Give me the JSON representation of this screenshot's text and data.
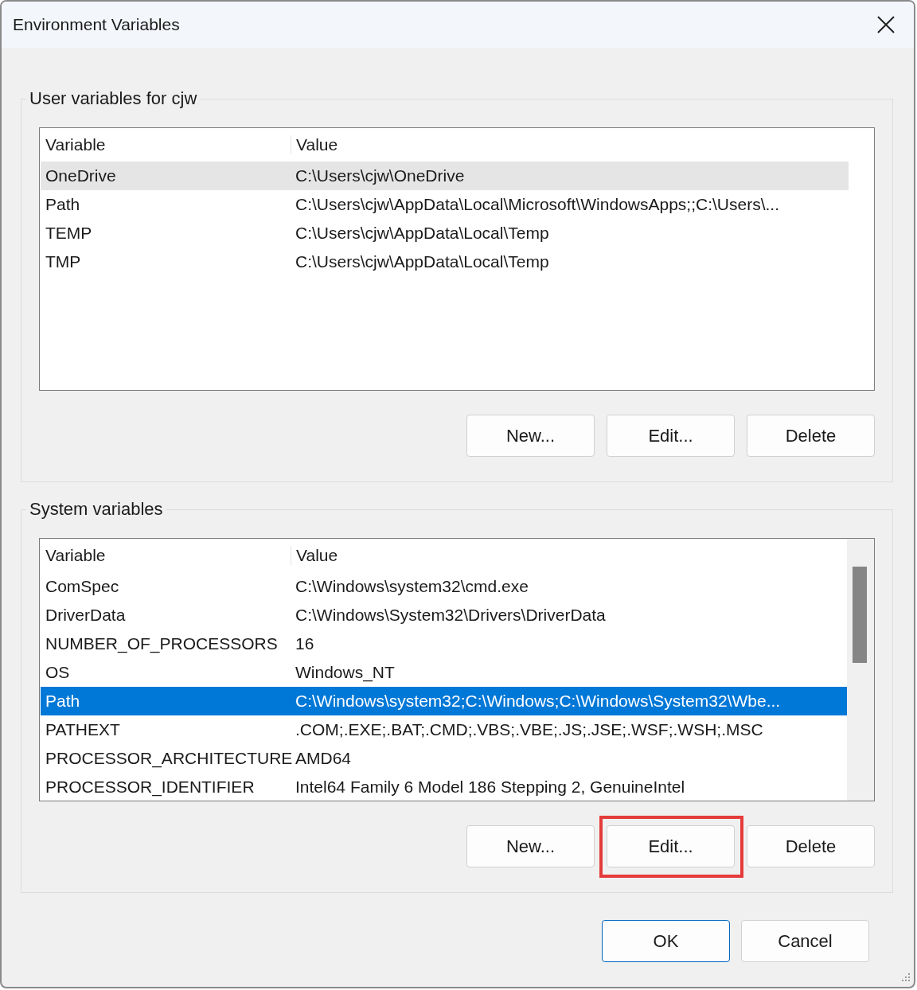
{
  "window": {
    "title": "Environment Variables"
  },
  "groups": [
    {
      "title": "User variables for cjw",
      "focused": false,
      "scrollbar": false,
      "columns": [
        "Variable",
        "Value"
      ],
      "rows": [
        {
          "name": "OneDrive",
          "value": "C:\\Users\\cjw\\OneDrive",
          "selected": true
        },
        {
          "name": "Path",
          "value": "C:\\Users\\cjw\\AppData\\Local\\Microsoft\\WindowsApps;;C:\\Users\\...",
          "selected": false
        },
        {
          "name": "TEMP",
          "value": "C:\\Users\\cjw\\AppData\\Local\\Temp",
          "selected": false
        },
        {
          "name": "TMP",
          "value": "C:\\Users\\cjw\\AppData\\Local\\Temp",
          "selected": false
        }
      ],
      "buttons": [
        {
          "label": "New..."
        },
        {
          "label": "Edit..."
        },
        {
          "label": "Delete"
        }
      ]
    },
    {
      "title": "System variables",
      "focused": true,
      "scrollbar": true,
      "columns": [
        "Variable",
        "Value"
      ],
      "rows": [
        {
          "name": "ComSpec",
          "value": "C:\\Windows\\system32\\cmd.exe",
          "selected": false
        },
        {
          "name": "DriverData",
          "value": "C:\\Windows\\System32\\Drivers\\DriverData",
          "selected": false
        },
        {
          "name": "NUMBER_OF_PROCESSORS",
          "value": "16",
          "selected": false
        },
        {
          "name": "OS",
          "value": "Windows_NT",
          "selected": false
        },
        {
          "name": "Path",
          "value": "C:\\Windows\\system32;C:\\Windows;C:\\Windows\\System32\\Wbe...",
          "selected": true
        },
        {
          "name": "PATHEXT",
          "value": ".COM;.EXE;.BAT;.CMD;.VBS;.VBE;.JS;.JSE;.WSF;.WSH;.MSC",
          "selected": false
        },
        {
          "name": "PROCESSOR_ARCHITECTURE",
          "value": "AMD64",
          "selected": false
        },
        {
          "name": "PROCESSOR_IDENTIFIER",
          "value": "Intel64 Family 6 Model 186 Stepping 2, GenuineIntel",
          "selected": false
        }
      ],
      "buttons": [
        {
          "label": "New..."
        },
        {
          "label": "Edit...",
          "highlighted": true
        },
        {
          "label": "Delete"
        }
      ]
    }
  ],
  "footer_buttons": [
    {
      "label": "OK",
      "default": true
    },
    {
      "label": "Cancel",
      "default": false
    }
  ]
}
